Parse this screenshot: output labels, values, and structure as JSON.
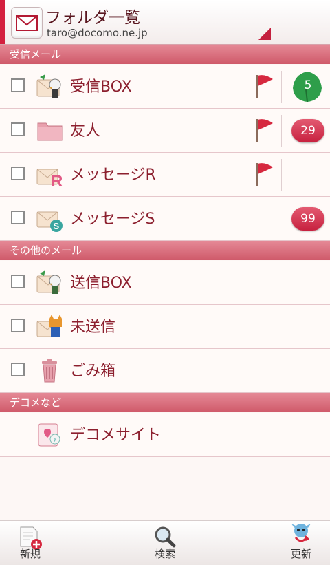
{
  "header": {
    "title": "フォルダ一覧",
    "account": "taro@docomo.ne.jp"
  },
  "sections": {
    "inbox": "受信メール",
    "other": "その他のメール",
    "deco": "デコメなど"
  },
  "rows": [
    {
      "label": "受信BOX",
      "flag": true,
      "leaf_count": "5"
    },
    {
      "label": "友人",
      "flag": true,
      "count": "29"
    },
    {
      "label": "メッセージR",
      "flag": true
    },
    {
      "label": "メッセージS",
      "count": "99"
    },
    {
      "label": "送信BOX"
    },
    {
      "label": "未送信"
    },
    {
      "label": "ごみ箱"
    },
    {
      "label": "デコメサイト"
    }
  ],
  "bottom_nav": {
    "new": "新規",
    "search": "検索",
    "refresh": "更新"
  },
  "colors": {
    "accent": "#d4203f",
    "section_bg": "#d9697a",
    "badge": "#d63a55",
    "leaf": "#2e9e4a"
  }
}
